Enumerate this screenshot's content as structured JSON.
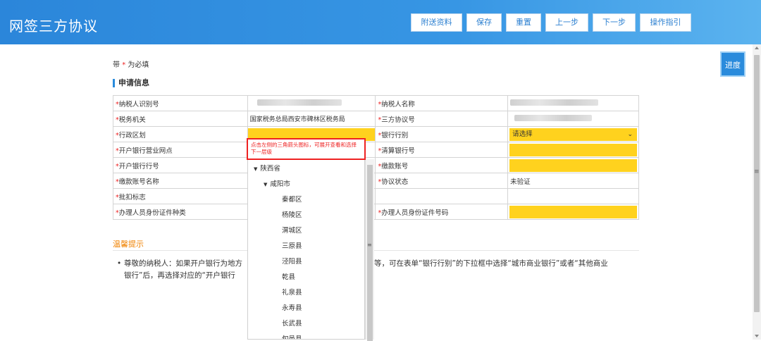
{
  "header": {
    "title": "网签三方协议",
    "buttons": [
      "附送资料",
      "保存",
      "重置",
      "上一步",
      "下一步",
      "操作指引"
    ]
  },
  "progress_button": "进度",
  "required_note": {
    "prefix": "带",
    "star": "*",
    "suffix": "为必填"
  },
  "section_title": "申请信息",
  "form": {
    "rows": [
      {
        "label1": "纳税人识别号",
        "value1": "",
        "label2": "纳税人名称",
        "value2": ""
      },
      {
        "label1": "税务机关",
        "value1": "国家税务总局西安市碑林区税务局",
        "label2": "三方协议号",
        "value2": ""
      },
      {
        "label1": "行政区划",
        "value1": "",
        "label2": "银行行别",
        "value2": "请选择"
      },
      {
        "label1": "开户银行营业网点",
        "value1": "",
        "label2": "清算银行号",
        "value2": ""
      },
      {
        "label1": "开户银行行号",
        "value1": "",
        "label2": "缴款账号",
        "value2": ""
      },
      {
        "label1": "缴款账号名称",
        "value1": "",
        "label2": "协议状态",
        "value2": "未验证"
      },
      {
        "label1": "批扣标志",
        "value1": "",
        "label2": "",
        "value2": ""
      },
      {
        "label1": "办理人员身份证件种类",
        "value1": "",
        "label2": "办理人员身份证件号码",
        "value2": ""
      }
    ]
  },
  "tooltip": {
    "line1": "点击左侧的三角箭头图标，可展开查看和选择",
    "line2": "下一层级"
  },
  "tree": {
    "province": "陕西省",
    "city": "咸阳市",
    "districts": [
      "秦都区",
      "杨陵区",
      "渭城区",
      "三原县",
      "泾阳县",
      "乾县",
      "礼泉县",
      "永寿县",
      "长武县",
      "旬邑县"
    ]
  },
  "tips": {
    "title": "温馨提示",
    "bullet": "•",
    "line1a": "尊敬的纳税人：如果开户银行为地方",
    "line1b": "等，可在表单“银行行别”的下拉框中选择“城市商业银行”或者“其他商业",
    "line2": "银行”后，再选择对应的“开户银行"
  },
  "colors": {
    "header": "#2b86da",
    "required": "#ffd21e",
    "accent": "#2a8bdc",
    "tips": "#f08200",
    "alert": "#e22222"
  }
}
